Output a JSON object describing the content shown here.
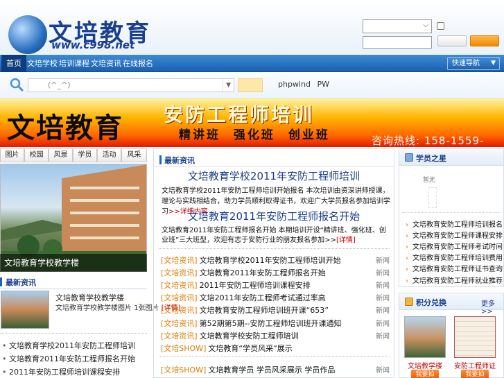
{
  "header": {
    "logo_title": "文培教育",
    "logo_url": "www.c998.net"
  },
  "nav": {
    "items": [
      "首页",
      "文培学校",
      "培训课程",
      "文培资讯",
      "在线报名"
    ],
    "right_select": "快速导航"
  },
  "search": {
    "placeholder": "(^_^)",
    "links": "phpwind  PW"
  },
  "banner": {
    "brand": "文培教育",
    "title": "安防工程师培训",
    "subtitle": "精讲班 强化班 创业班",
    "hotline": "咨询热线: 158-1559-2630"
  },
  "left": {
    "tabs": [
      "图片",
      "校园",
      "风景",
      "学员",
      "活动",
      "风采"
    ],
    "photo_caption": "文培教育学校教学楼",
    "section_title": "最新资讯",
    "thumb_title": "文培教育学校教学楼",
    "thumb_desc": "文培教育学校教学楼图片 1张图片",
    "thumb_more": "[详情]",
    "items": [
      "文培教育学校2011年安防工程师培训",
      "文培教育2011年安防工程师报名开始",
      "2011年安防工程师培训课程安排"
    ]
  },
  "middle": {
    "section_title": "最新资讯",
    "headline_1": "文培教育学校2011年安防工程师培训",
    "headline_1_desc": "文培教育学校2011年安防工程师培训开始报名 本次培训由资深讲师授课，理论与实践相结合，助力学员顺利取得证书，欢迎广大学员报名参加培训学习",
    "headline_1_more": ">>详细内容",
    "headline_2": "文培教育2011年安防工程师报名开始",
    "headline_2_desc": "文培教育2011年安防工程师报名开始 本期培训开设“精讲班、强化班、创业班”三大班型，欢迎有志于安防行业的朋友报名参加>>",
    "headline_2_more": "[详情]",
    "news": [
      {
        "tag": "[文培资讯]",
        "title": "文培教育学校2011年安防工程师培训开始",
        "date": "新闻"
      },
      {
        "tag": "[文培资讯]",
        "title": "文培教育2011年安防工程师报名开始",
        "date": "新闻"
      },
      {
        "tag": "[文培资讯]",
        "title": "2011年安防工程师培训课程安排",
        "date": "新闻"
      },
      {
        "tag": "[文培资讯]",
        "title": "文培2011年安防工程师考试通过率高",
        "date": "新闻"
      },
      {
        "tag": "[文培资讯]",
        "title": "文培教育安防工程师培训班开课“653”",
        "date": "新闻"
      },
      {
        "tag": "[文培资讯]",
        "title": "第52期第5期--安防工程师培训班开课通知",
        "date": "新闻"
      },
      {
        "tag": "[文培资讯]",
        "title": "文培教育学校安防工程师培训",
        "date": "新闻"
      },
      {
        "tag": "[文培SHOW]",
        "title": "文培教育“学员风采”展示",
        "date": ""
      },
      {
        "tag": "[文培SHOW]",
        "title": "文培教育学员 学员风采展示 学员作品",
        "date": "新闻"
      }
    ]
  },
  "right": {
    "section_1_title": "学员之星",
    "avatar_label": "暂无",
    "items": [
      "文培教育安防工程师培训报名",
      "文培教育安防工程师课程安排",
      "文培教育安防工程师考试时间",
      "文培教育安防工程师培训费用",
      "文培教育安防工程师证书查询",
      "文培教育安防工程师就业推荐"
    ],
    "section_2_title": "积分兑换",
    "section_2_more": "更多>>",
    "prizes": [
      {
        "label": "文培教学楼",
        "button": "我要拍"
      },
      {
        "label": "安防工程师证",
        "button": "我要拍"
      }
    ]
  }
}
